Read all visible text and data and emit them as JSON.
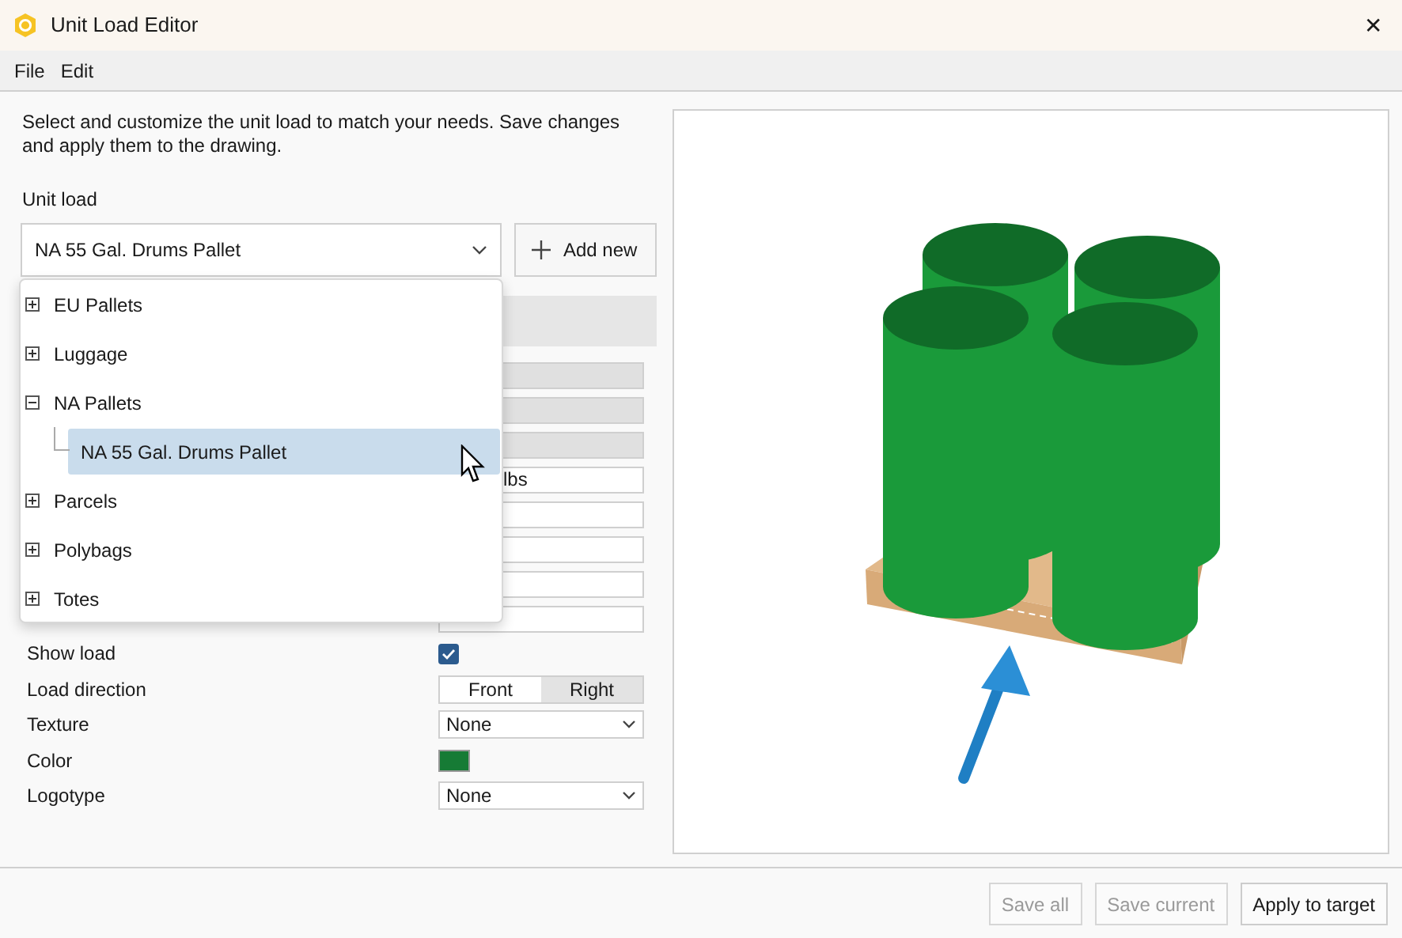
{
  "window": {
    "title": "Unit Load Editor",
    "close": "✕"
  },
  "menu": [
    "File",
    "Edit"
  ],
  "intro": "Select and customize the unit load to match your needs. Save changes and apply them to the drawing.",
  "unit_load": {
    "label": "Unit load",
    "value": "NA 55 Gal. Drums Pallet",
    "add_button": "Add new"
  },
  "dropdown_tree": [
    {
      "label": "EU Pallets",
      "expanded": false,
      "selected": false
    },
    {
      "label": "Luggage",
      "expanded": false,
      "selected": false
    },
    {
      "label": "NA Pallets",
      "expanded": true,
      "selected": false,
      "children": [
        {
          "label": "NA 55 Gal. Drums Pallet",
          "selected": true
        }
      ]
    },
    {
      "label": "Parcels",
      "expanded": false,
      "selected": false
    },
    {
      "label": "Polybags",
      "expanded": false,
      "selected": false
    },
    {
      "label": "Totes",
      "expanded": false,
      "selected": false
    }
  ],
  "covered_fields": [
    {
      "disabled": true
    },
    {
      "disabled": true
    },
    {
      "disabled": true
    },
    {
      "disabled": false,
      "value": "lbs"
    },
    {
      "disabled": false
    },
    {
      "disabled": false
    },
    {
      "disabled": false
    },
    {
      "disabled": false
    }
  ],
  "properties": [
    {
      "kind": "checkbox",
      "label": "Show load",
      "checked": true
    },
    {
      "kind": "segmented",
      "label": "Load direction",
      "options": [
        {
          "label": "Front",
          "selected": true
        },
        {
          "label": "Right",
          "selected": false
        }
      ]
    },
    {
      "kind": "select",
      "label": "Texture",
      "value": "None"
    },
    {
      "kind": "color",
      "label": "Color",
      "color": "#167b35"
    },
    {
      "kind": "select",
      "label": "Logotype",
      "value": "None"
    }
  ],
  "footer_buttons": [
    {
      "label": "Save all",
      "disabled": true
    },
    {
      "label": "Save current",
      "disabled": true
    },
    {
      "label": "Apply to target",
      "disabled": false
    }
  ]
}
